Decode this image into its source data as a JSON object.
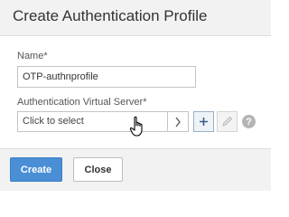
{
  "dialog": {
    "title": "Create Authentication Profile"
  },
  "form": {
    "name_label": "Name*",
    "name_value": "OTP-authnprofile",
    "vserver_label": "Authentication Virtual Server*",
    "vserver_placeholder": "Click to select",
    "help_glyph": "?"
  },
  "icons": {
    "arrow": "chevron-right-icon",
    "add": "plus-icon",
    "edit": "pencil-icon",
    "help": "question-icon",
    "cursor": "hand-cursor-icon"
  },
  "footer": {
    "create_label": "Create",
    "close_label": "Close"
  },
  "colors": {
    "primary": "#4a8fd6",
    "header_bg": "#f2f2f2",
    "border": "#c4c4c4"
  }
}
